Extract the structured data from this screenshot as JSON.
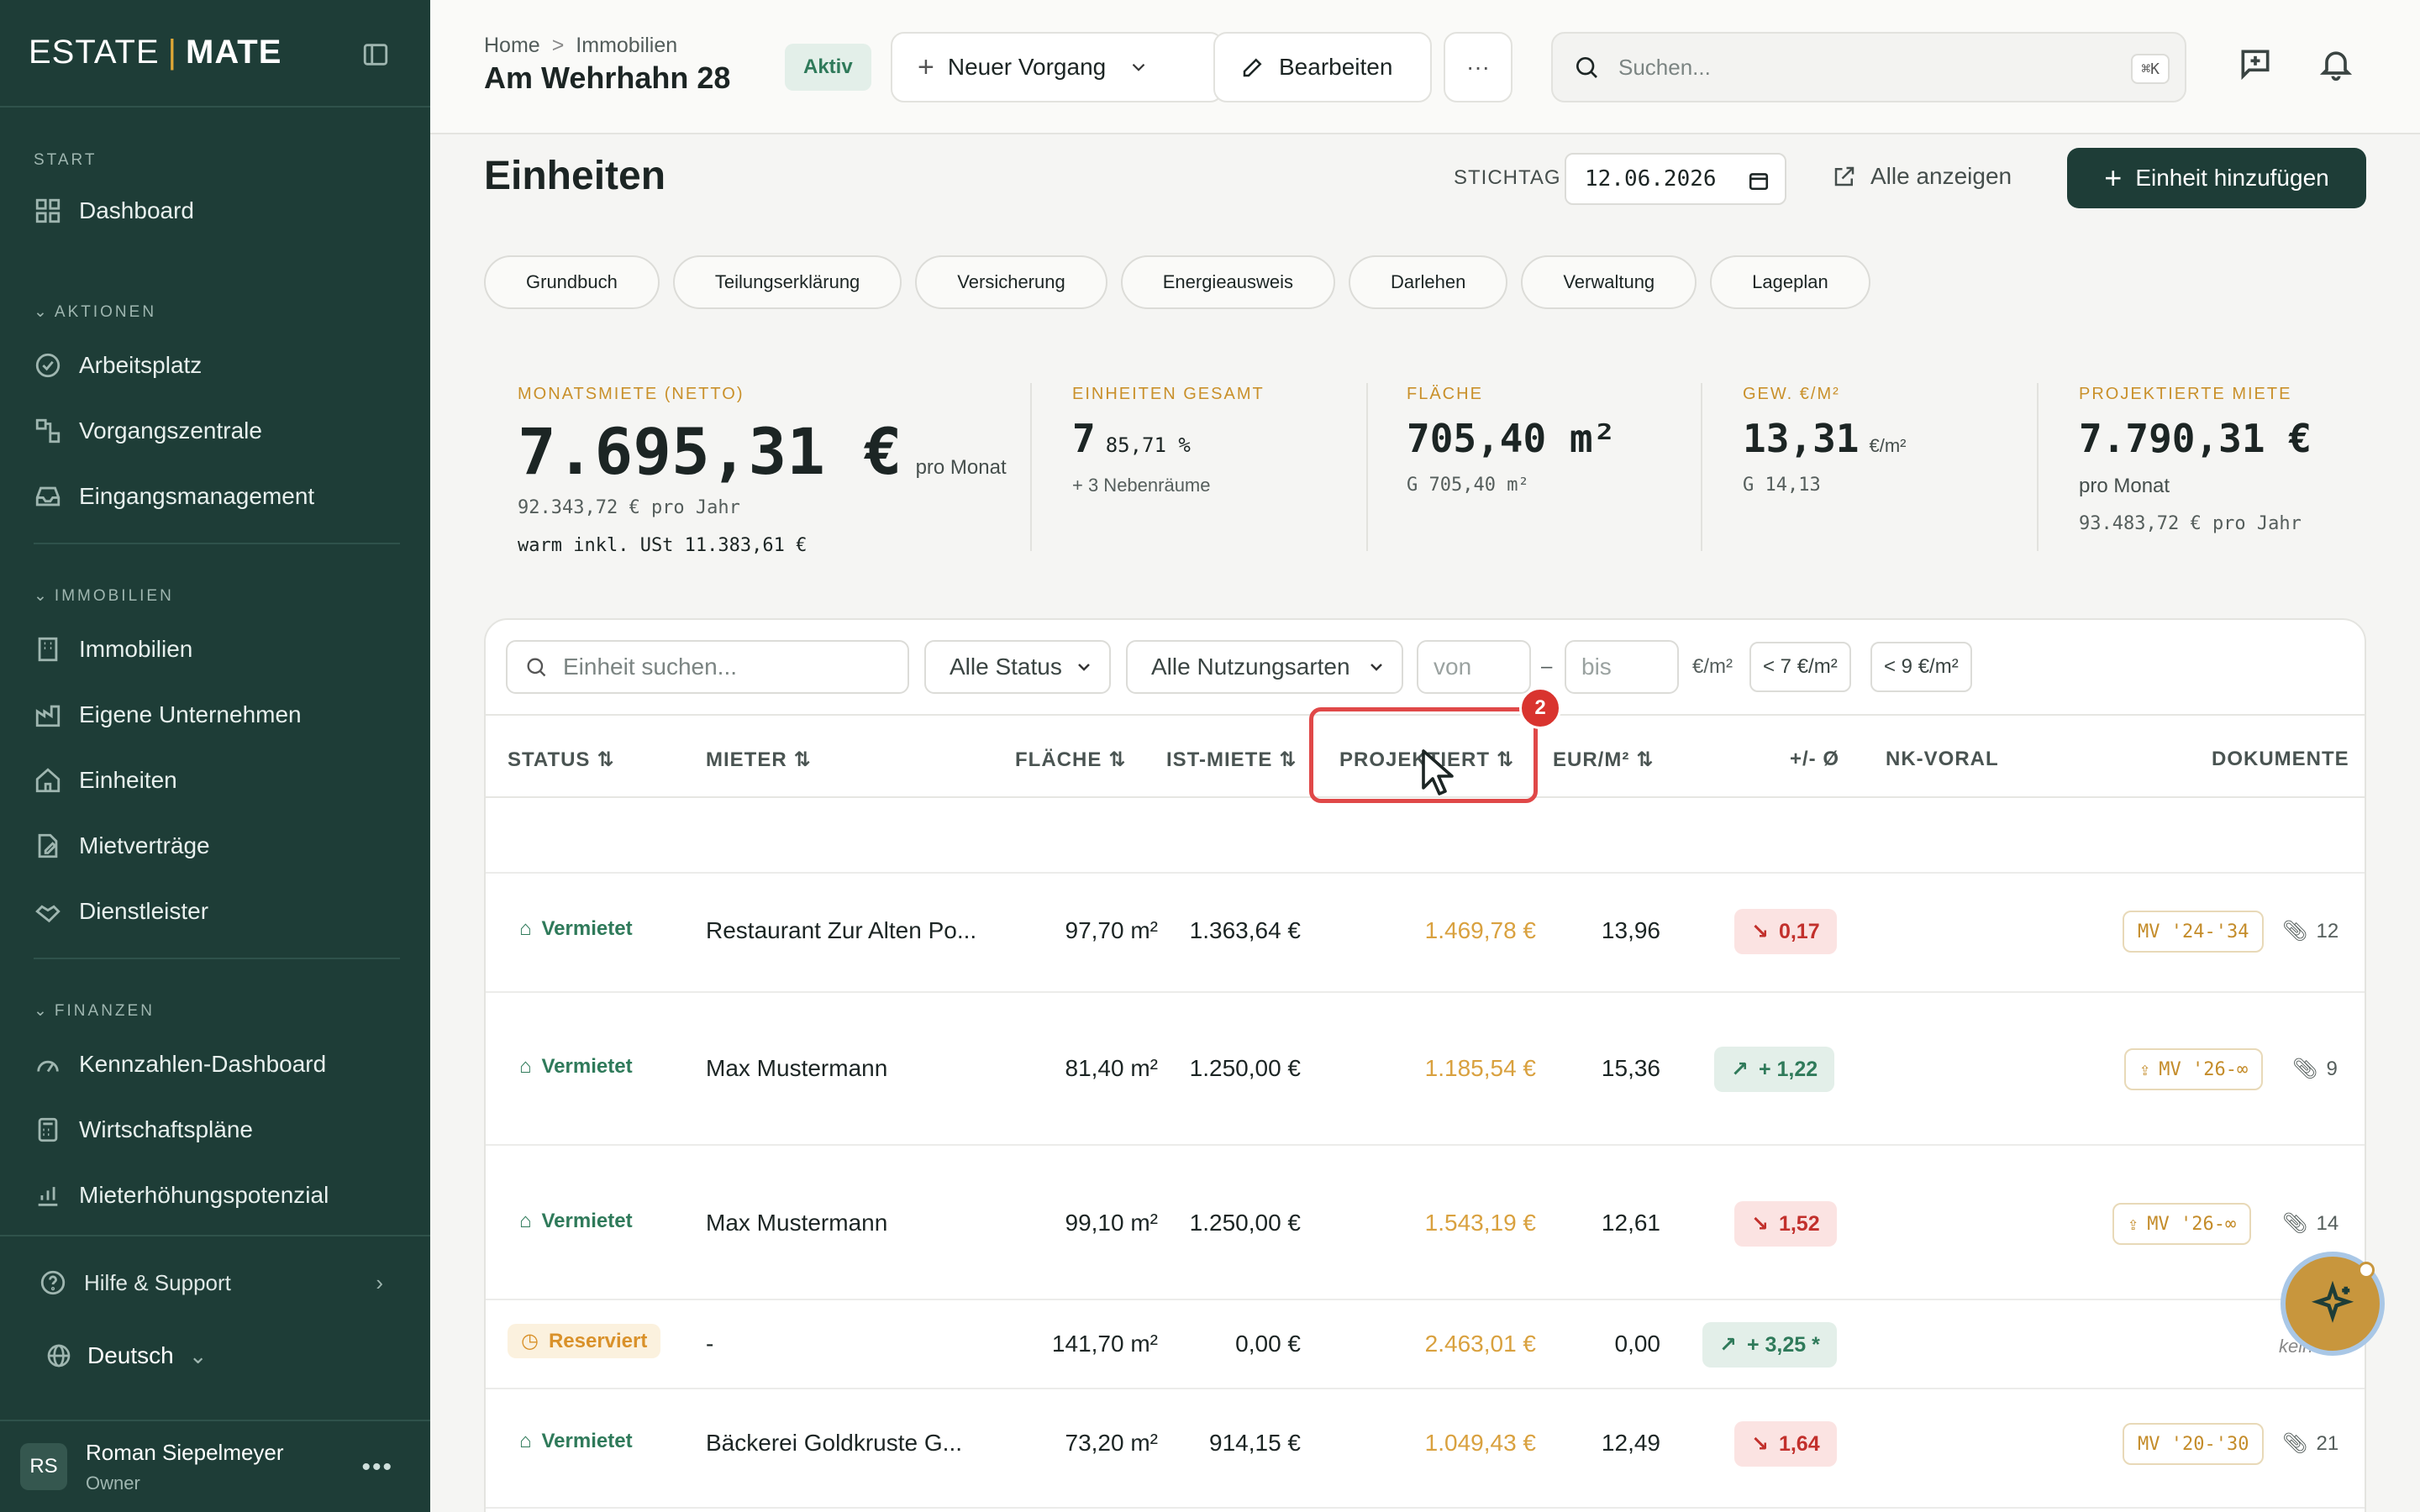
{
  "sidebar": {
    "logo_left": "ESTATE",
    "logo_sep": "|",
    "logo_right": "MATE",
    "start_label": "START",
    "dashboard": "Dashboard",
    "aktionen_label": "AKTIONEN",
    "aktionen": [
      "Arbeitsplatz",
      "Vorgangszentrale",
      "Eingangsmanagement"
    ],
    "immobilien_label": "IMMOBILIEN",
    "immobilien": [
      "Immobilien",
      "Eigene Unternehmen",
      "Einheiten",
      "Mietverträge",
      "Dienstleister"
    ],
    "finanzen_label": "FINANZEN",
    "finanzen": [
      "Kennzahlen-Dashboard",
      "Wirtschaftspläne",
      "Mieterhöhungspotenzial"
    ],
    "help": "Hilfe & Support",
    "language": "Deutsch",
    "user": {
      "initials": "RS",
      "name": "Roman Siepelmeyer",
      "role": "Owner"
    }
  },
  "header": {
    "breadcrumb_home": "Home",
    "breadcrumb_sep": ">",
    "breadcrumb_current": "Immobilien",
    "title": "Am Wehrhahn 28",
    "status": "Aktiv",
    "new_case": "Neuer Vorgang",
    "edit": "Bearbeiten",
    "more": "···",
    "search_placeholder": "Suchen...",
    "shortcut": "⌘K"
  },
  "main": {
    "title": "Einheiten",
    "stichtag_label": "STICHTAG",
    "stichtag_value": "12.06.2026",
    "show_all": "Alle anzeigen",
    "add_unit": "Einheit hinzufügen",
    "chips": [
      "Grundbuch",
      "Teilungserklärung",
      "Versicherung",
      "Energieausweis",
      "Darlehen",
      "Verwaltung",
      "Lageplan"
    ]
  },
  "kpis": {
    "rent_label": "MONATSMIETE (NETTO)",
    "rent_value": "7.695,31 €",
    "rent_unit": "pro Monat",
    "rent_year": "92.343,72 € pro Jahr",
    "rent_warm": "warm inkl. USt 11.383,61 €",
    "units_label": "EINHEITEN GESAMT",
    "units_value": "7",
    "units_pct": "85,71 %",
    "units_sub": "+ 3 Nebenräume",
    "area_label": "FLÄCHE",
    "area_value": "705,40 m²",
    "area_sub": "G 705,40 m²",
    "eur_label": "GEW. €/M²",
    "eur_value": "13,31",
    "eur_unit": "€/m²",
    "eur_sub": "G 14,13",
    "proj_label": "PROJEKTIERTE MIETE",
    "proj_value": "7.790,31 €",
    "proj_unit": "pro Monat",
    "proj_year": "93.483,72 € pro Jahr"
  },
  "filters": {
    "search_placeholder": "Einheit suchen...",
    "status": "Alle Status",
    "usage": "Alle Nutzungsarten",
    "from_placeholder": "von",
    "dash": "–",
    "to_placeholder": "bis",
    "unit": "€/m²",
    "quick1": "< 7 €/m²",
    "quick2": "< 9 €/m²"
  },
  "table": {
    "columns": [
      "STATUS",
      "MIETER",
      "FLÄCHE",
      "IST-MIETE",
      "PROJEKTIERT",
      "EUR/M²",
      "+/- Ø",
      "NK-VORAL",
      "DOKUMENTE"
    ],
    "rows": [
      {
        "status": "Vermietet",
        "tenant": "Restaurant Zur Alten Po...",
        "area": "97,70 m²",
        "rent": "1.363,64 €",
        "proj": "1.469,78 €",
        "eur": "13,96",
        "delta": "0,17",
        "delta_type": "neg",
        "doc": "MV '24-'34",
        "doc_upload": false,
        "att": "12"
      },
      {
        "status": "Vermietet",
        "tenant": "Max Mustermann",
        "area": "81,40 m²",
        "rent": "1.250,00 €",
        "proj": "1.185,54 €",
        "eur": "15,36",
        "delta": "+ 1,22",
        "delta_type": "pos",
        "doc": "MV '26-∞",
        "doc_upload": true,
        "att": "9"
      },
      {
        "status": "Vermietet",
        "tenant": "Max Mustermann",
        "area": "99,10 m²",
        "rent": "1.250,00 €",
        "proj": "1.543,19 €",
        "eur": "12,61",
        "delta": "1,52",
        "delta_type": "neg",
        "doc": "MV '26-∞",
        "doc_upload": true,
        "att": "14"
      },
      {
        "status": "Reserviert",
        "tenant": "-",
        "area": "141,70 m²",
        "rent": "0,00 €",
        "proj": "2.463,01 €",
        "eur": "0,00",
        "delta": "+ 3,25 *",
        "delta_type": "pos",
        "doc": "kein",
        "doc_upload": false,
        "att": ""
      },
      {
        "status": "Vermietet",
        "tenant": "Bäckerei Goldkruste G...",
        "area": "73,20 m²",
        "rent": "914,15 €",
        "proj": "1.049,43 €",
        "eur": "12,49",
        "delta": "1,64",
        "delta_type": "neg",
        "doc": "MV '20-'30",
        "doc_upload": false,
        "att": "21"
      }
    ]
  },
  "annotation": {
    "step": "2"
  },
  "colors": {
    "sidebar": "#1e3d37",
    "accent": "#d9a13f",
    "positive": "#2f7a5a",
    "negative": "#c2302c",
    "highlight": "#e04848"
  }
}
